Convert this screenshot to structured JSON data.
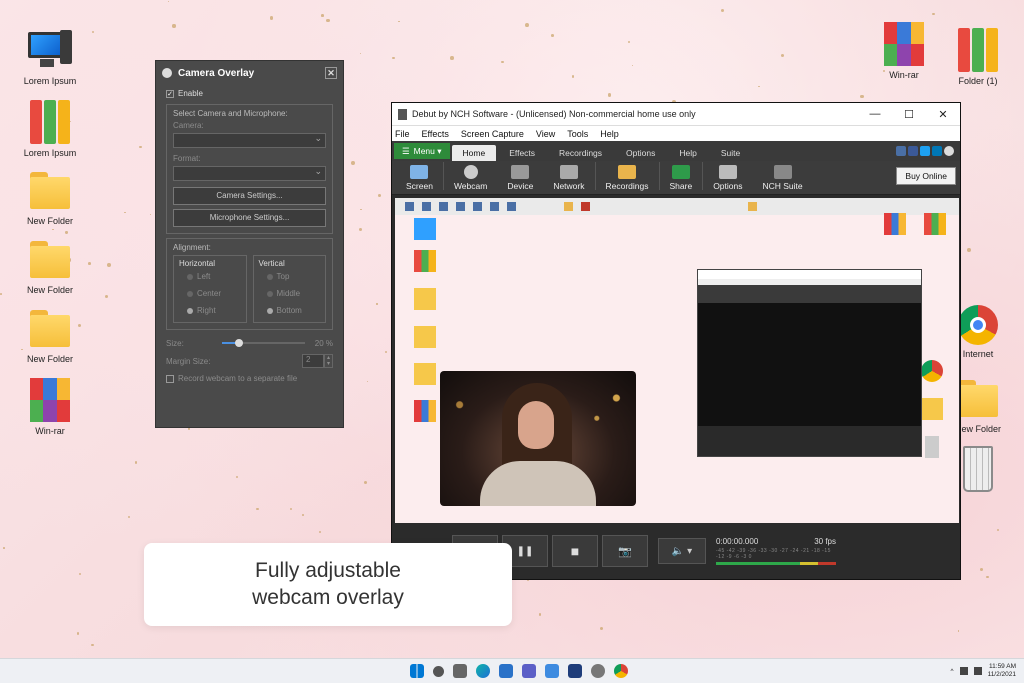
{
  "desktop": {
    "left_icons": [
      {
        "label": "Lorem Ipsum",
        "icon": "computer-icon"
      },
      {
        "label": "Lorem Ipsum",
        "icon": "binders-icon"
      },
      {
        "label": "New Folder",
        "icon": "folder-icon"
      },
      {
        "label": "New Folder",
        "icon": "folder-icon"
      },
      {
        "label": "New Folder",
        "icon": "folder-icon"
      },
      {
        "label": "Win-rar",
        "icon": "winrar-icon"
      }
    ],
    "right_icons": [
      {
        "label": "Win-rar",
        "icon": "winrar-icon"
      },
      {
        "label": "Folder (1)",
        "icon": "binders-icon"
      },
      {
        "label": "Internet",
        "icon": "chrome-icon"
      },
      {
        "label": "New Folder",
        "icon": "folder-icon"
      },
      {
        "label": "",
        "icon": "recycle-bin-icon"
      }
    ]
  },
  "camera_overlay": {
    "title": "Camera Overlay",
    "close": "✕",
    "enable_check": "✓",
    "enable": "Enable",
    "select_group": "Select Camera and Microphone:",
    "camera_label": "Camera:",
    "format_label": "Format:",
    "camera_settings": "Camera Settings...",
    "microphone_settings": "Microphone Settings...",
    "alignment_label": "Alignment:",
    "horizontal": "Horizontal",
    "vertical": "Vertical",
    "h_options": [
      "Left",
      "Center",
      "Right"
    ],
    "v_options": [
      "Top",
      "Middle",
      "Bottom"
    ],
    "size_label": "Size:",
    "size_value": "20 %",
    "size_fraction": 0.2,
    "margin_label": "Margin Size:",
    "margin_value": "2",
    "record_separate": "Record webcam to a separate file"
  },
  "debut": {
    "title": "Debut by NCH Software - (Unlicensed) Non-commercial home use only",
    "window_controls": [
      "—",
      "☐",
      "✕"
    ],
    "menu": [
      "File",
      "Effects",
      "Screen Capture",
      "View",
      "Tools",
      "Help"
    ],
    "menu_button": "Menu ▾",
    "tabs": [
      "Home",
      "Effects",
      "Recordings",
      "Options",
      "Help",
      "Suite"
    ],
    "toolbar": [
      "Screen",
      "Webcam",
      "Device",
      "Network",
      "Recordings",
      "Share",
      "Options",
      "NCH Suite"
    ],
    "buy_online": "Buy Online",
    "time": "0:00:00.000",
    "fps": "30 fps",
    "meter_scale": "-45 -42 -39 -36 -33 -30 -27 -24 -21 -18 -15 -12 -9 -6 -3 0",
    "controls": {
      "record": "●",
      "pause": "❚❚",
      "stop": "■",
      "snapshot": "📷",
      "volume": "🔈 ▾"
    }
  },
  "caption": {
    "line1": "Fully adjustable",
    "line2": "webcam overlay"
  },
  "taskbar": {
    "time": "11:59 AM",
    "date": "11/2/2021",
    "tray_caret": "^"
  }
}
